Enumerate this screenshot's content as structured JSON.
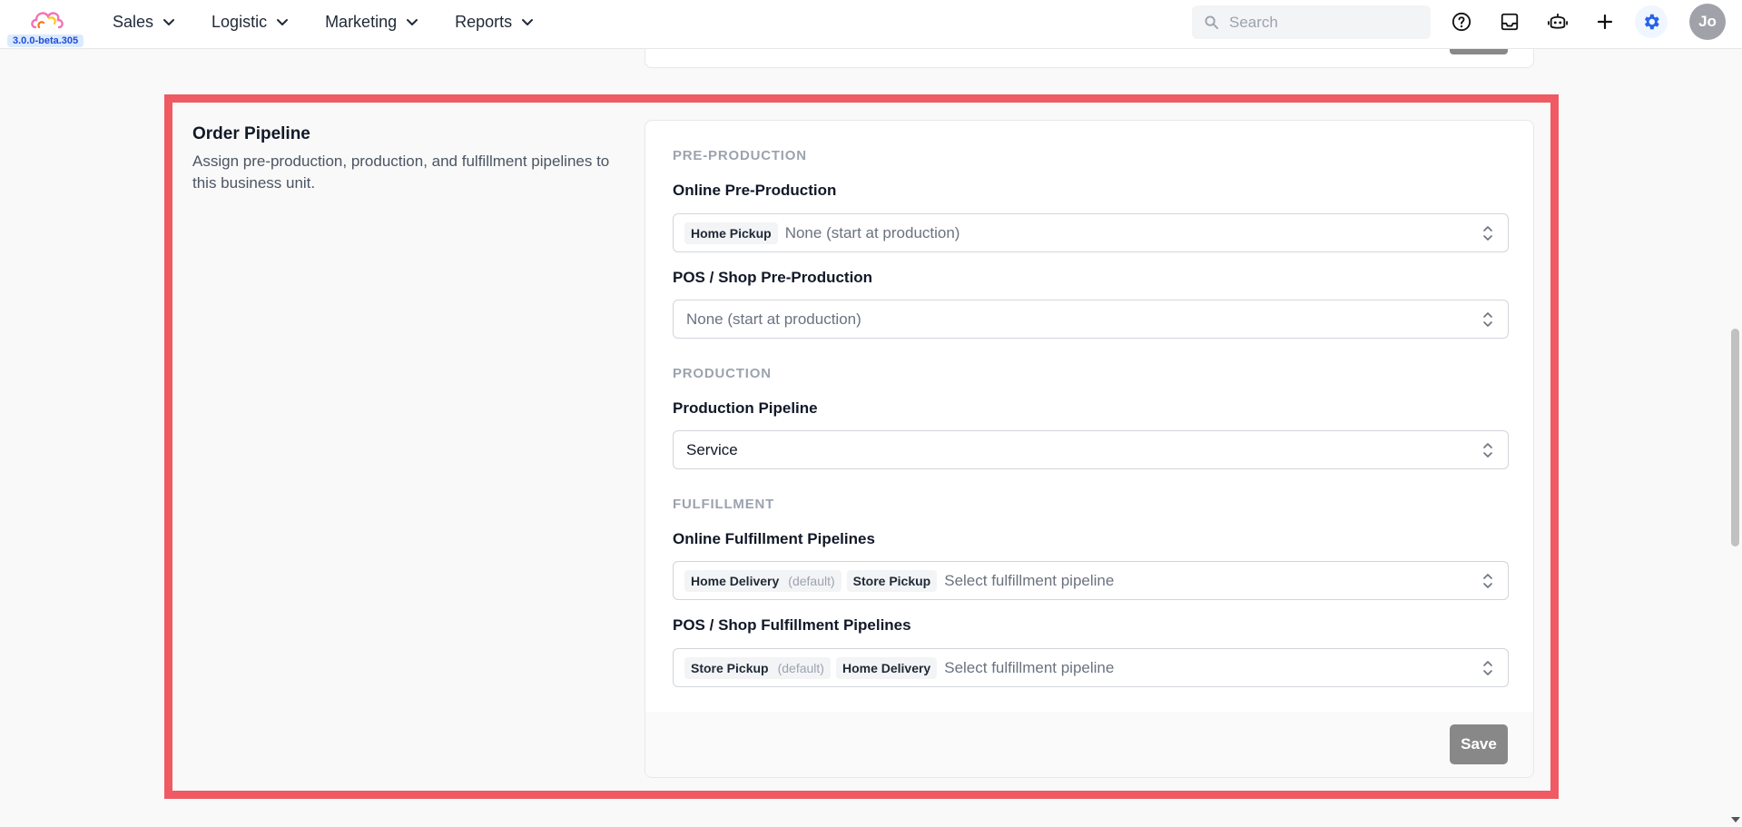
{
  "app": {
    "version": "3.0.0-beta.305",
    "accent_color": "#1d4ed8",
    "highlight_color": "#ef5a63"
  },
  "nav": {
    "items": [
      {
        "label": "Sales",
        "icon": "chevron-down-icon"
      },
      {
        "label": "Logistic",
        "icon": "chevron-down-icon"
      },
      {
        "label": "Marketing",
        "icon": "chevron-down-icon"
      },
      {
        "label": "Reports",
        "icon": "chevron-down-icon"
      }
    ]
  },
  "search": {
    "placeholder": "Search",
    "icon": "search-icon"
  },
  "toolbar": {
    "icons": [
      "help-icon",
      "inbox-icon",
      "bot-icon",
      "plus-icon",
      "gear-icon"
    ]
  },
  "user": {
    "initials": "Jo"
  },
  "section": {
    "title": "Order Pipeline",
    "description": "Assign pre-production, production, and fulfillment pipelines to this business unit."
  },
  "form": {
    "pre_production": {
      "group_label": "PRE-PRODUCTION",
      "online": {
        "label": "Online Pre-Production",
        "chips": [
          "Home Pickup"
        ],
        "placeholder": "None (start at production)"
      },
      "pos": {
        "label": "POS / Shop Pre-Production",
        "placeholder": "None (start at production)"
      }
    },
    "production": {
      "group_label": "PRODUCTION",
      "pipeline": {
        "label": "Production Pipeline",
        "value": "Service"
      }
    },
    "fulfillment": {
      "group_label": "FULFILLMENT",
      "online": {
        "label": "Online Fulfillment Pipelines",
        "chips": [
          {
            "label": "Home Delivery",
            "default_tag": "(default)"
          },
          {
            "label": "Store Pickup"
          }
        ],
        "placeholder": "Select fulfillment pipeline"
      },
      "pos": {
        "label": "POS / Shop Fulfillment Pipelines",
        "chips": [
          {
            "label": "Store Pickup",
            "default_tag": "(default)"
          },
          {
            "label": "Home Delivery"
          }
        ],
        "placeholder": "Select fulfillment pipeline"
      }
    },
    "save_label": "Save"
  }
}
